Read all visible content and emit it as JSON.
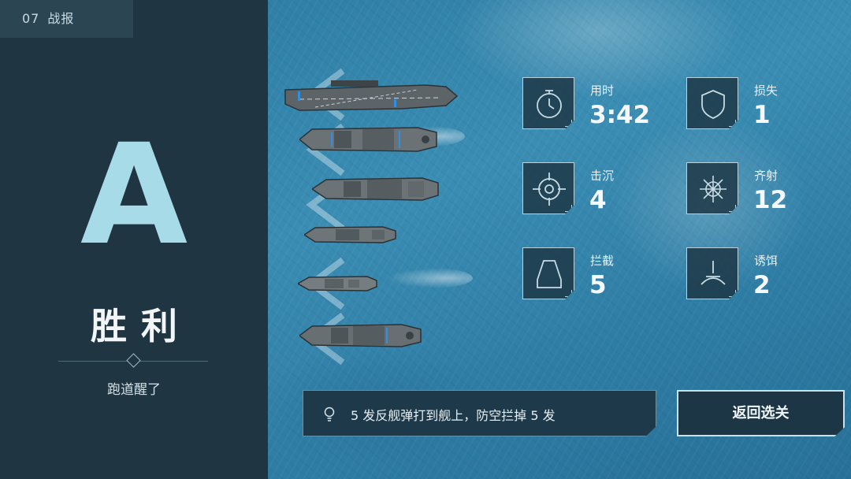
{
  "mission": {
    "number": "07",
    "title": "战报"
  },
  "grade": "A",
  "result": "胜利",
  "subtitle": "跑道醒了",
  "stats": [
    {
      "icon": "timer-icon",
      "label": "用时",
      "value": "3:42"
    },
    {
      "icon": "shield-icon",
      "label": "损失",
      "value": "1"
    },
    {
      "icon": "crosshair-icon",
      "label": "击沉",
      "value": "4"
    },
    {
      "icon": "salvo-burst-icon",
      "label": "齐射",
      "value": "12"
    },
    {
      "icon": "intercept-icon",
      "label": "拦截",
      "value": "5"
    },
    {
      "icon": "decoy-icon",
      "label": "诱饵",
      "value": "2"
    }
  ],
  "tip": {
    "icon": "lightbulb-icon",
    "text": "5 发反舰弹打到舰上，防空拦掉 5 发"
  },
  "back_button": "返回选关",
  "colors": {
    "grade": "#a8dbe8",
    "panel": "#203542",
    "ocean": "#3389b0"
  }
}
